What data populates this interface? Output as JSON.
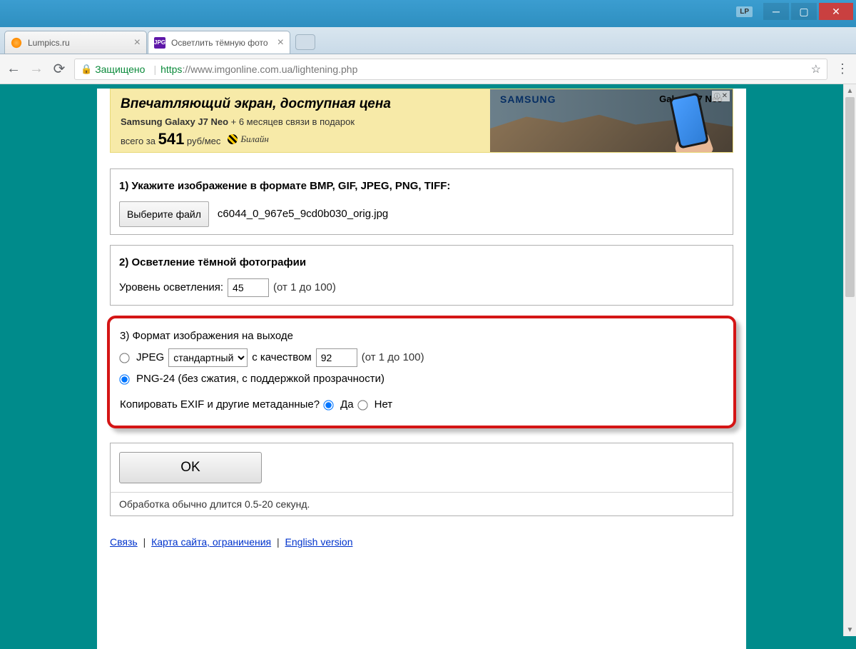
{
  "window": {
    "lp_badge": "LP"
  },
  "tabs": [
    {
      "title": "Lumpics.ru",
      "active": false
    },
    {
      "title": "Осветлить тёмную фото",
      "active": true
    }
  ],
  "addressbar": {
    "secure_label": "Защищено",
    "protocol": "https",
    "url_rest": "://www.imgonline.com.ua/lightening.php"
  },
  "ad": {
    "headline": "Впечатляющий экран, доступная цена",
    "line2_bold": "Samsung Galaxy J7 Neo",
    "line2_rest": " + 6 месяцев связи в подарок",
    "line3_prefix": "всего за ",
    "price": "541",
    "line3_suffix": " руб/мес",
    "beeline": "Билайн",
    "brand": "SAMSUNG",
    "product": "Galaxy J7 Neo",
    "badge_info": "ⓘ",
    "badge_x": "✕"
  },
  "step1": {
    "title": "1) Укажите изображение в формате BMP, GIF, JPEG, PNG, TIFF:",
    "choose_label": "Выберите файл",
    "filename": "c6044_0_967e5_9cd0b030_orig.jpg"
  },
  "step2": {
    "title": "2) Осветление тёмной фотографии",
    "level_label": "Уровень осветления:",
    "level_value": "45",
    "hint": "(от 1 до 100)"
  },
  "step3": {
    "title": "3) Формат изображения на выходе",
    "jpeg_label": "JPEG",
    "jpeg_mode": "стандартный",
    "quality_label": "с качеством",
    "quality_value": "92",
    "quality_hint": "(от 1 до 100)",
    "png_label": "PNG-24 (без сжатия, с поддержкой прозрачности)",
    "exif_label": "Копировать EXIF и другие метаданные?",
    "yes": "Да",
    "no": "Нет"
  },
  "submit": {
    "ok": "OK",
    "note": "Обработка обычно длится 0.5-20 секунд."
  },
  "footer": {
    "link1": "Связь",
    "link2": "Карта сайта, ограничения",
    "link3": "English version"
  }
}
